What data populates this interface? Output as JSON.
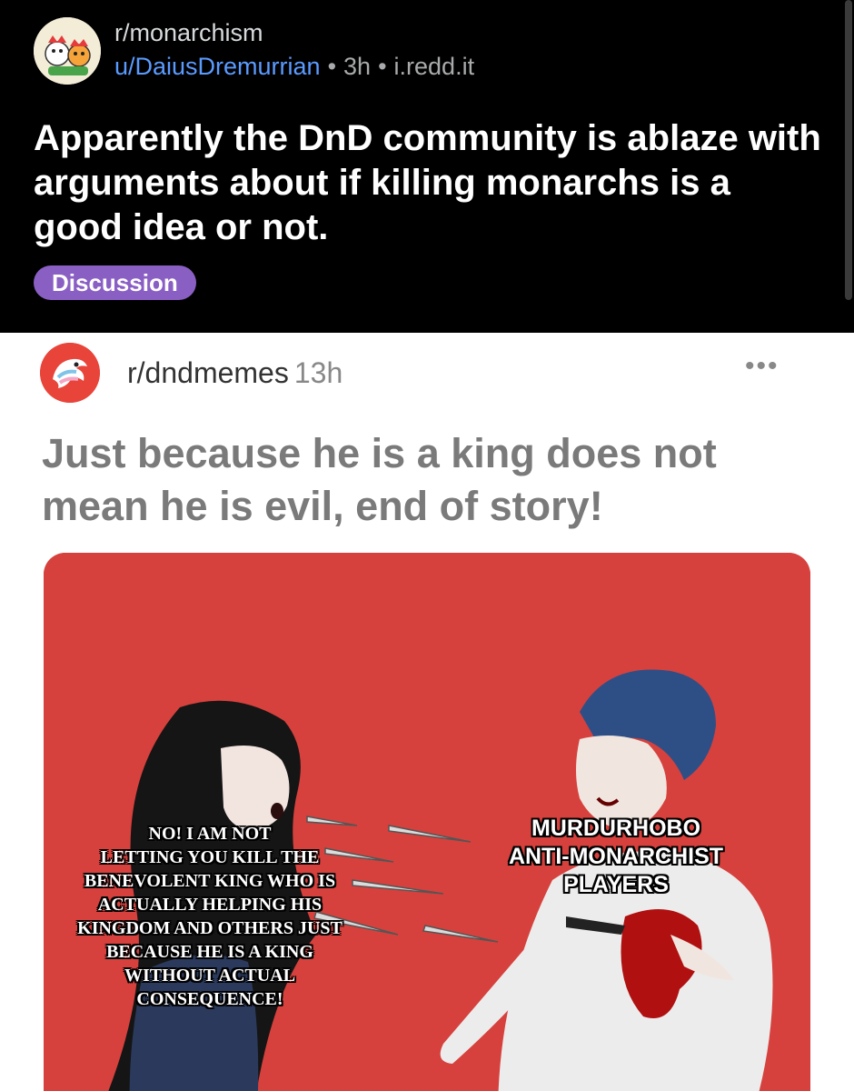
{
  "post": {
    "subreddit": "r/monarchism",
    "author": "u/DaiusDremurrian",
    "separator": "•",
    "age": "3h",
    "domain": "i.redd.it",
    "title": "Apparently the DnD community is ablaze with arguments about if killing monarchs is a good idea or not.",
    "flair": "Discussion",
    "flair_color": "#8a5fc4",
    "author_color": "#5b9bff"
  },
  "embed": {
    "subreddit": "r/dndmemes",
    "age": "13h",
    "more_icon": "•••",
    "title": "Just because he is a king does not mean he is evil, end of story!",
    "meme": {
      "caption_left": "NO! I AM NOT\nLETTING YOU KILL THE\nBENEVOLENT KING WHO IS\nACTUALLY HELPING HIS\nKINGDOM AND OTHERS JUST\nBECAUSE HE IS A KING\nWITHOUT ACTUAL CONSEQUENCE!",
      "caption_right": "MURDURHOBO\nANTI-MONARCHIST PLAYERS",
      "background_color": "#d6413d"
    }
  }
}
